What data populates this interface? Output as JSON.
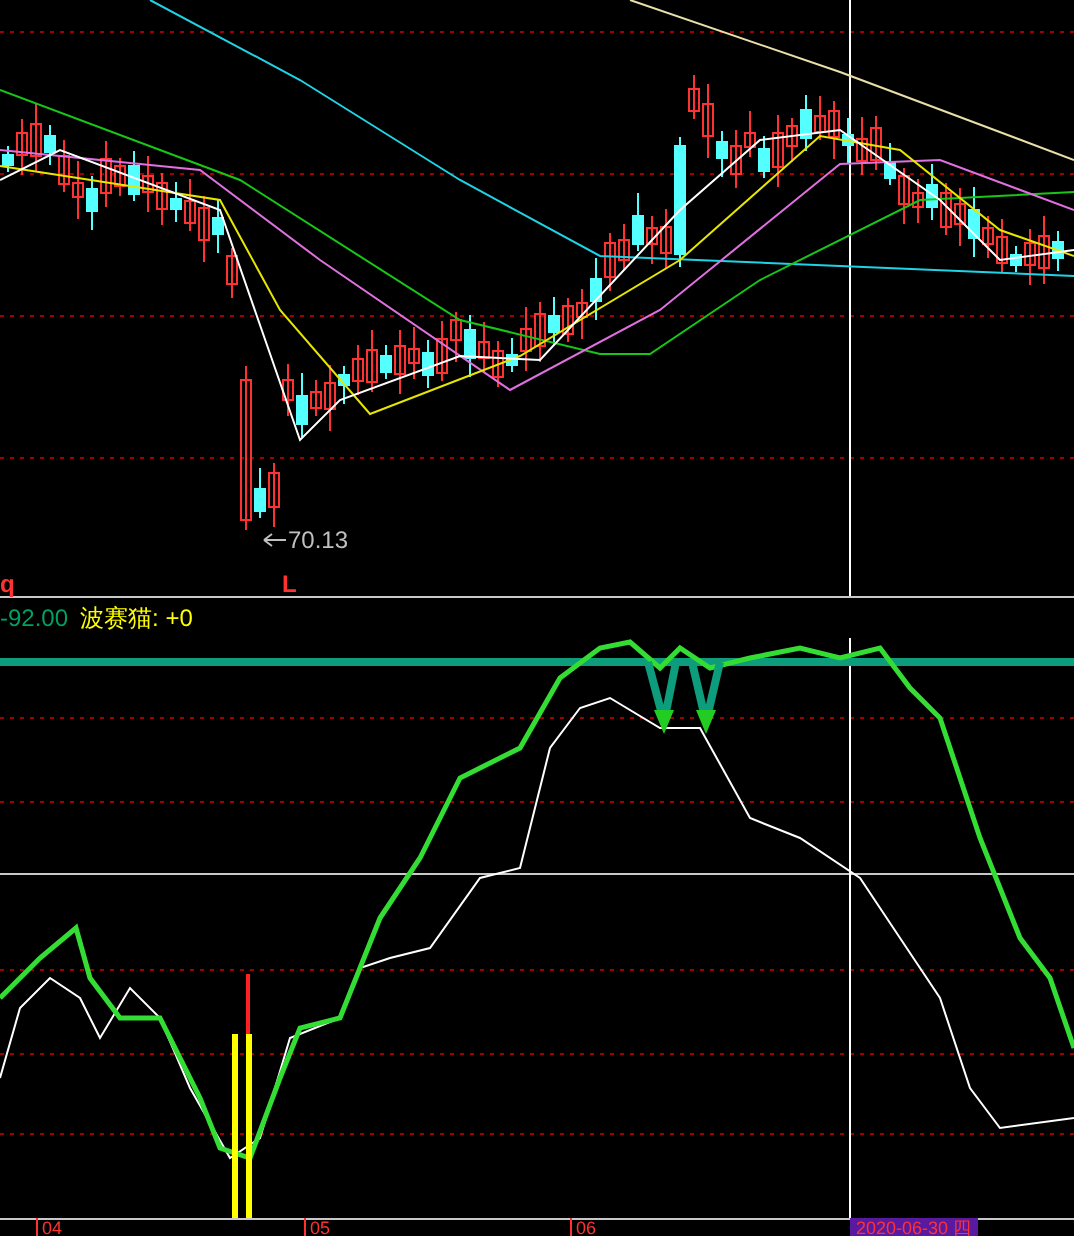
{
  "price_panel": {
    "low_marker": "70.13",
    "left_flag": "q",
    "low_flag": "L"
  },
  "indicator_panel": {
    "value": "-92.00",
    "label": "波赛猫: +0"
  },
  "time_axis": {
    "ticks": [
      "04",
      "05",
      "06"
    ],
    "cursor_date": "2020-06-30 四"
  }
}
